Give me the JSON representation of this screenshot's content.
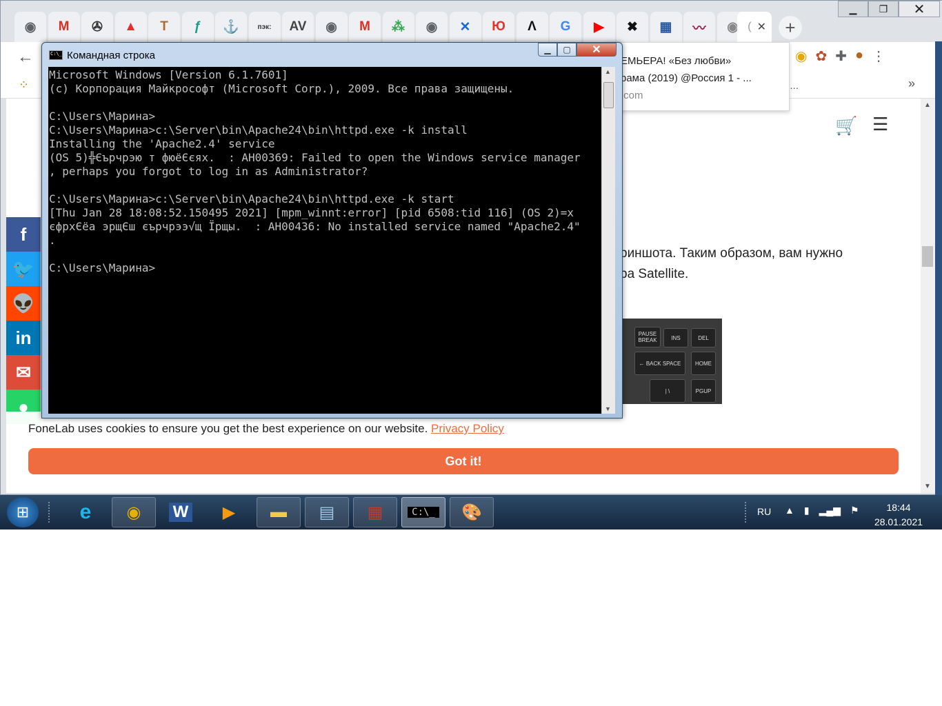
{
  "browser": {
    "tabs": [
      {
        "icon": "chrome-icon",
        "glyph": "◉",
        "color": "#5f6368"
      },
      {
        "icon": "gmail-icon",
        "glyph": "M",
        "color": "#d93025"
      },
      {
        "icon": "pinwheel-icon",
        "glyph": "✇",
        "color": "#333333"
      },
      {
        "icon": "triangle-logo-icon",
        "glyph": "▲",
        "color": "#e52d2d"
      },
      {
        "icon": "letter-t-icon",
        "glyph": "T",
        "color": "#b06a2c"
      },
      {
        "icon": "script-f-icon",
        "glyph": "ƒ",
        "color": "#1a9c8b"
      },
      {
        "icon": "anchor-icon",
        "glyph": "⚓",
        "color": "#1a3e8c"
      },
      {
        "icon": "pek-icon",
        "glyph": "пэк:",
        "color": "#333333"
      },
      {
        "icon": "av-icon",
        "glyph": "AV",
        "color": "#444444"
      },
      {
        "icon": "globe-icon",
        "glyph": "◉",
        "color": "#5f6368"
      },
      {
        "icon": "gmail-icon",
        "glyph": "M",
        "color": "#d93025"
      },
      {
        "icon": "dots-icon",
        "glyph": "⁂",
        "color": "#34a853"
      },
      {
        "icon": "globe-icon",
        "glyph": "◉",
        "color": "#5f6368"
      },
      {
        "icon": "confluence-icon",
        "glyph": "✕",
        "color": "#1868db"
      },
      {
        "icon": "yu-icon",
        "glyph": "Ю",
        "color": "#e4322b"
      },
      {
        "icon": "letter-a-icon",
        "glyph": "Λ",
        "color": "#111111"
      },
      {
        "icon": "translate-icon",
        "glyph": "G",
        "color": "#4285f4"
      },
      {
        "icon": "youtube-icon",
        "glyph": "▶",
        "color": "#ff0000"
      },
      {
        "icon": "raiffeisen-icon",
        "glyph": "✖",
        "color": "#111111"
      },
      {
        "icon": "bank-icon",
        "glyph": "▦",
        "color": "#2c5aa0"
      },
      {
        "icon": "swoosh-icon",
        "glyph": "〰",
        "color": "#a01f4c"
      },
      {
        "icon": "globe-icon",
        "glyph": "◉",
        "color": "#888888"
      }
    ],
    "active_tab_text": "(",
    "suggestion": {
      "line1": "ЕМЬЕРА! «Без любви»",
      "line2": "рама (2019) @Россия 1  - ...",
      "line3": ".com",
      "more": "..."
    }
  },
  "page": {
    "article_line1": "риншота. Таким образом, вам нужно",
    "article_line2": "ра Satellite.",
    "keys": {
      "pause": "PAUSE BREAK",
      "ins": "INS",
      "del": "DEL",
      "backspace": "← BACK SPACE",
      "home": "HOME",
      "pipe": "| \\",
      "pgup": "PGUP"
    },
    "social": [
      {
        "name": "facebook-button",
        "glyph": "f",
        "color": "#3b5998"
      },
      {
        "name": "twitter-button",
        "glyph": "🐦",
        "color": "#1da1f2"
      },
      {
        "name": "reddit-button",
        "glyph": "👽",
        "color": "#ff4500"
      },
      {
        "name": "linkedin-button",
        "glyph": "in",
        "color": "#0077b5"
      },
      {
        "name": "gmail-share-button",
        "glyph": "✉",
        "color": "#dd4b39"
      },
      {
        "name": "whatsapp-button",
        "glyph": "●",
        "color": "#25d366"
      }
    ],
    "cookie": {
      "text": "FoneLab uses cookies to ensure you get the best experience on our website.",
      "link": "Privacy Policy",
      "button": "Got it!"
    }
  },
  "cmd": {
    "title": "Командная строка",
    "lines": [
      "Microsoft Windows [Version 6.1.7601]",
      "(c) Корпорация Майкрософт (Microsoft Corp.), 2009. Все права защищены.",
      "",
      "C:\\Users\\Марина>",
      "C:\\Users\\Марина>c:\\Server\\bin\\Apache24\\bin\\httpd.exe -k install",
      "Installing the 'Apache2.4' service",
      "(OS 5)╬Єърчрэю т фюёЄєях.  : AH00369: Failed to open the Windows service manager",
      ", perhaps you forgot to log in as Administrator?",
      "",
      "C:\\Users\\Марина>c:\\Server\\bin\\Apache24\\bin\\httpd.exe -k start",
      "[Thu Jan 28 18:08:52.150495 2021] [mpm_winnt:error] [pid 6508:tid 116] (OS 2)=х",
      "єфрхЄёа эрщЄш єърчрээ√щ Їрщы.  : AH00436: No installed service named \"Apache2.4\"",
      ".",
      "",
      "C:\\Users\\Марина>"
    ]
  },
  "taskbar": {
    "lang": "RU",
    "time": "18:44",
    "date": "28.01.2021"
  }
}
